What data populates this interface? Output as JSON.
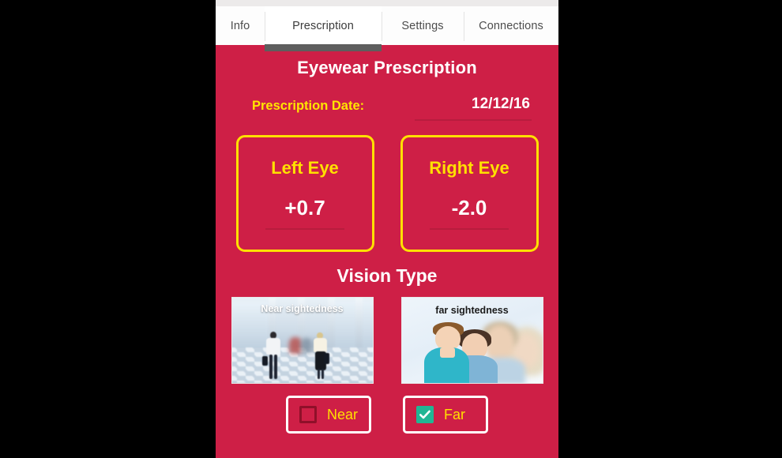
{
  "app": {
    "panel_bg": "#CE1F46",
    "accent_yellow": "#FFE000",
    "accent_teal": "#21B694"
  },
  "tabs": [
    {
      "label": "Info",
      "active": false
    },
    {
      "label": "Prescription",
      "active": true
    },
    {
      "label": "Settings",
      "active": false
    },
    {
      "label": "Connections",
      "active": false
    }
  ],
  "header": {
    "title": "Eyewear Prescription"
  },
  "date_field": {
    "label": "Prescription Date:",
    "value": "12/12/16"
  },
  "eyes": [
    {
      "name": "Left Eye",
      "value": "+0.7"
    },
    {
      "name": "Right Eye",
      "value": "-2.0"
    }
  ],
  "vision": {
    "section_title": "Vision Type",
    "options": [
      {
        "image_caption": "Near sightedness",
        "checkbox_label": "Near",
        "checked": false
      },
      {
        "image_caption": "far sightedness",
        "checkbox_label": "Far",
        "checked": true
      }
    ]
  }
}
